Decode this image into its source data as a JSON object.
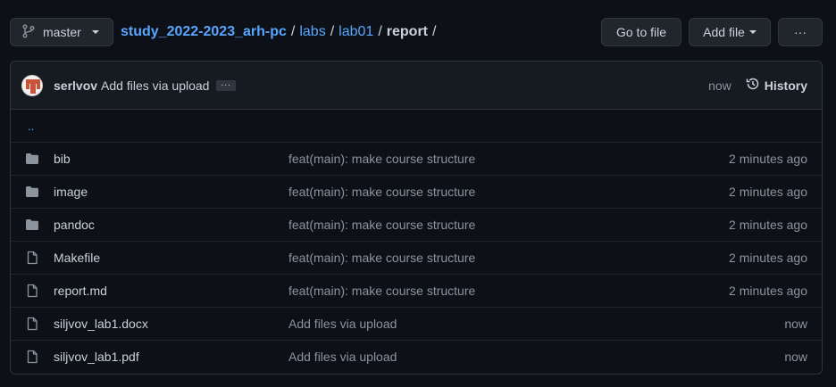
{
  "branch": {
    "label": "master"
  },
  "breadcrumb": {
    "repo": "study_2022-2023_arh-pc",
    "sep": "/",
    "parts": [
      "labs",
      "lab01"
    ],
    "current": "report"
  },
  "actions": {
    "goto_label": "Go to file",
    "addfile_label": "Add file",
    "more_label": "···"
  },
  "commit": {
    "author": "serlvov",
    "message": "Add files via upload",
    "ellipsis": "...",
    "time": "now",
    "history_label": "History"
  },
  "updir": "..",
  "files": [
    {
      "type": "folder",
      "name": "bib",
      "message": "feat(main): make course structure",
      "age": "2 minutes ago"
    },
    {
      "type": "folder",
      "name": "image",
      "message": "feat(main): make course structure",
      "age": "2 minutes ago"
    },
    {
      "type": "folder",
      "name": "pandoc",
      "message": "feat(main): make course structure",
      "age": "2 minutes ago"
    },
    {
      "type": "file",
      "name": "Makefile",
      "message": "feat(main): make course structure",
      "age": "2 minutes ago"
    },
    {
      "type": "file",
      "name": "report.md",
      "message": "feat(main): make course structure",
      "age": "2 minutes ago"
    },
    {
      "type": "file",
      "name": "siljvov_lab1.docx",
      "message": "Add files via upload",
      "age": "now"
    },
    {
      "type": "file",
      "name": "siljvov_lab1.pdf",
      "message": "Add files via upload",
      "age": "now"
    }
  ],
  "colors": {
    "background": "#0d1117",
    "link": "#58a6ff",
    "muted": "#8b949e",
    "border": "#30363d"
  }
}
